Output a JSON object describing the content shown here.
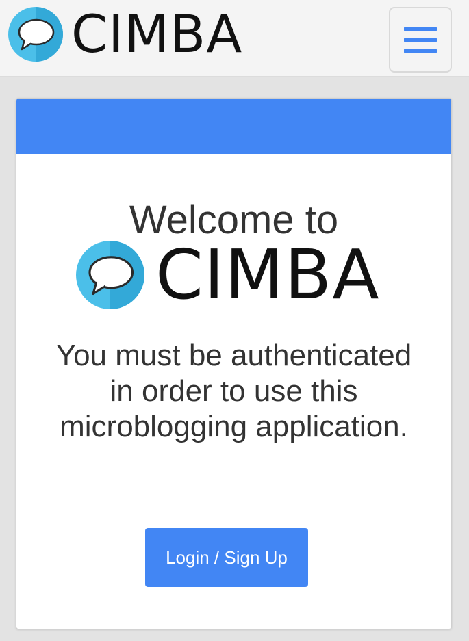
{
  "header": {
    "brand_name": "CIMBA",
    "logo_icon": "speech-bubble-icon",
    "menu_icon": "hamburger-icon"
  },
  "card": {
    "welcome_text": "Welcome to",
    "brand_name": "CIMBA",
    "message": "You must be authenticated in order to use this microblogging application.",
    "login_label": "Login / Sign Up"
  },
  "colors": {
    "accent": "#4286f4",
    "logo_light": "#4bbfe9",
    "logo_dark": "#33a9d8",
    "text": "#333333"
  }
}
